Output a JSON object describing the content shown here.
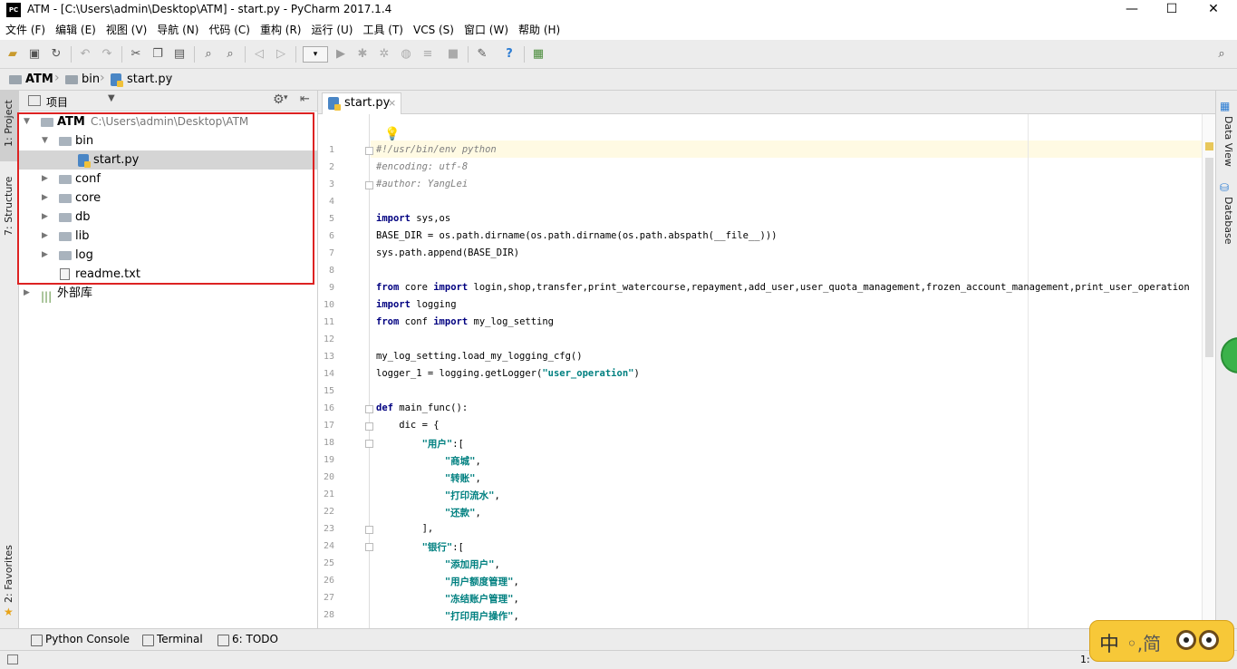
{
  "window": {
    "app_badge": "PC",
    "title": "ATM - [C:\\Users\\admin\\Desktop\\ATM] - start.py - PyCharm 2017.1.4"
  },
  "menu": [
    "文件 (F)",
    "编辑 (E)",
    "视图 (V)",
    "导航 (N)",
    "代码 (C)",
    "重构 (R)",
    "运行 (U)",
    "工具 (T)",
    "VCS (S)",
    "窗口 (W)",
    "帮助 (H)"
  ],
  "breadcrumb": [
    "ATM",
    "bin",
    "start.py"
  ],
  "left_tabs": {
    "project": "1: Project",
    "structure": "7: Structure",
    "favorites": "2: Favorites"
  },
  "project_panel": {
    "title": "项目"
  },
  "tree": [
    {
      "label": "ATM",
      "path": "C:\\Users\\admin\\Desktop\\ATM"
    },
    {
      "label": "bin"
    },
    {
      "label": "start.py"
    },
    {
      "label": "conf"
    },
    {
      "label": "core"
    },
    {
      "label": "db"
    },
    {
      "label": "lib"
    },
    {
      "label": "log"
    },
    {
      "label": "readme.txt"
    },
    {
      "label": "外部库"
    }
  ],
  "editor_tab": "start.py",
  "code": [
    "#!/usr/bin/env python",
    "#encoding: utf-8",
    "#author: YangLei",
    "",
    "import sys,os",
    "BASE_DIR = os.path.dirname(os.path.dirname(os.path.abspath(__file__)))",
    "sys.path.append(BASE_DIR)",
    "",
    "from core import login,shop,transfer,print_watercourse,repayment,add_user,user_quota_management,frozen_account_management,print_user_operation",
    "import logging",
    "from conf import my_log_setting",
    "",
    "my_log_setting.load_my_logging_cfg()",
    "logger_1 = logging.getLogger(\"user_operation\")",
    "",
    "def main_func():",
    "    dic = {",
    "        \"用户\":[",
    "            \"商城\",",
    "            \"转账\",",
    "            \"打印流水\",",
    "            \"还款\",",
    "        ],",
    "        \"银行\":[",
    "            \"添加用户\",",
    "            \"用户额度管理\",",
    "            \"冻结账户管理\",",
    "            \"打印用户操作\","
  ],
  "right_tabs": {
    "data_view": "Data View",
    "database": "Database"
  },
  "bottom_tabs": {
    "python_console": "Python Console",
    "terminal": "Terminal",
    "todo": "6: TODO"
  },
  "status": {
    "position": "1:"
  },
  "ime": {
    "label": "中",
    "rest": "◦,简"
  }
}
